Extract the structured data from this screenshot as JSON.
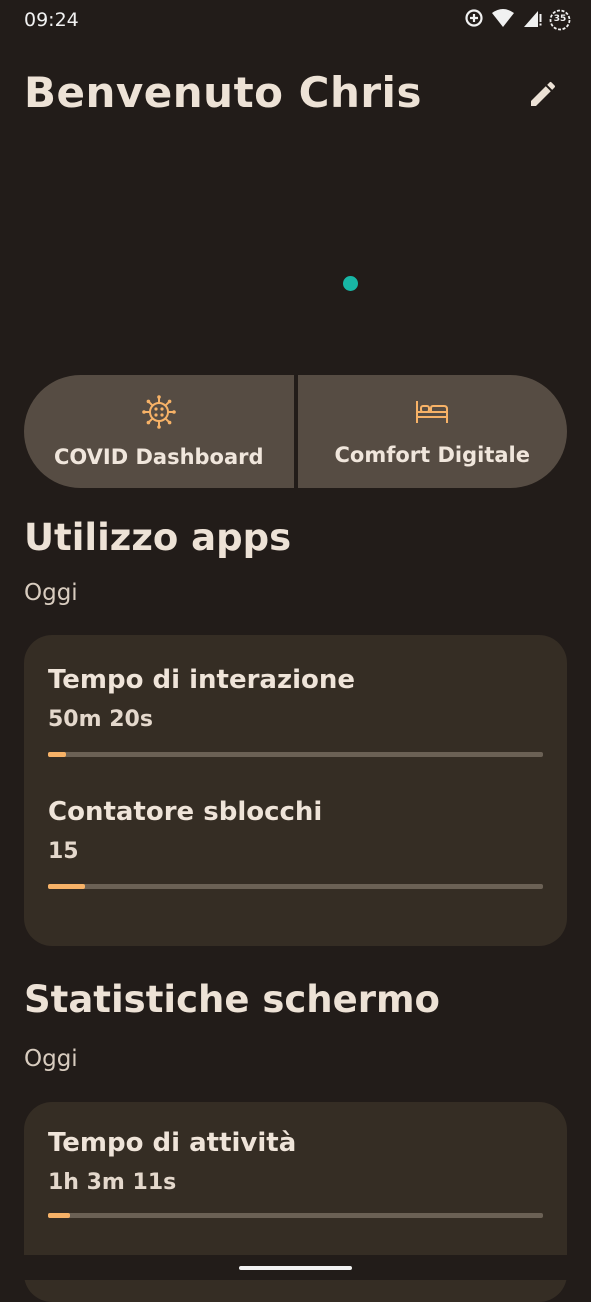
{
  "status_bar": {
    "time": "09:24",
    "battery_level": "35",
    "icons": [
      "data-saver-icon",
      "wifi-icon",
      "cellular-signal-icon",
      "battery-icon"
    ]
  },
  "header": {
    "title": "Benvenuto Chris",
    "edit_icon": "pencil-icon"
  },
  "accent_colors": {
    "background": "#221c19",
    "shortcut": "#564c43",
    "card": "#352d24",
    "progress": "#f7b267",
    "indicator_dot": "#18b6a5"
  },
  "shortcuts": [
    {
      "label": "COVID Dashboard",
      "icon": "virus-icon"
    },
    {
      "label": "Comfort Digitale",
      "icon": "bed-icon"
    }
  ],
  "app_usage": {
    "title": "Utilizzo apps",
    "period": "Oggi",
    "metrics": [
      {
        "label": "Tempo di interazione",
        "value": "50m 20s",
        "progress": 0.036
      },
      {
        "label": "Contatore sblocchi",
        "value": "15",
        "progress": 0.075
      }
    ]
  },
  "screen_stats": {
    "title": "Statistiche schermo",
    "period": "Oggi",
    "metrics": [
      {
        "label": "Tempo di attività",
        "value": "1h 3m 11s",
        "progress": 0.045
      }
    ]
  }
}
